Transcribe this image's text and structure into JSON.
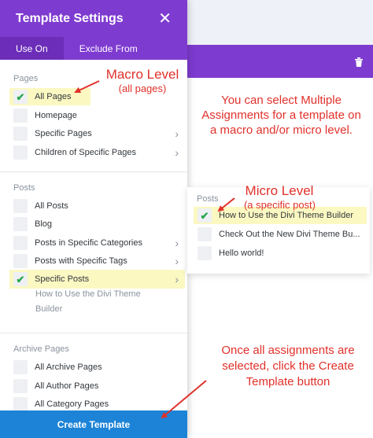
{
  "modal": {
    "title": "Template Settings",
    "close_icon": "close-icon",
    "tabs": [
      {
        "label": "Use On",
        "active": true
      },
      {
        "label": "Exclude From",
        "active": false
      }
    ]
  },
  "pages_section": {
    "label": "Pages",
    "items": [
      {
        "label": "All Pages",
        "checked": true
      },
      {
        "label": "Homepage",
        "checked": false
      },
      {
        "label": "Specific Pages",
        "checked": false,
        "has_submenu": true
      },
      {
        "label": "Children of Specific Pages",
        "checked": false,
        "has_submenu": true
      }
    ]
  },
  "posts_section": {
    "label": "Posts",
    "items": [
      {
        "label": "All Posts",
        "checked": false
      },
      {
        "label": "Blog",
        "checked": false
      },
      {
        "label": "Posts in Specific Categories",
        "checked": false,
        "has_submenu": true
      },
      {
        "label": "Posts with Specific Tags",
        "checked": false,
        "has_submenu": true
      },
      {
        "label": "Specific Posts",
        "checked": true,
        "has_submenu": true
      }
    ],
    "selected_sub": "How to Use the Divi Theme Builder"
  },
  "archive_section": {
    "label": "Archive Pages",
    "items": [
      {
        "label": "All Archive Pages",
        "checked": false
      },
      {
        "label": "All Author Pages",
        "checked": false
      },
      {
        "label": "All Category Pages",
        "checked": false
      }
    ]
  },
  "create_button": "Create Template",
  "posts_panel": {
    "label": "Posts",
    "items": [
      {
        "label": "How to Use the Divi Theme Builder",
        "checked": true
      },
      {
        "label": "Check Out the New Divi Theme Bu...",
        "checked": false
      },
      {
        "label": "Hello world!",
        "checked": false
      }
    ]
  },
  "annotations": {
    "macro_title": "Macro Level",
    "macro_sub": "(all pages)",
    "multiple": "You can select  Multiple Assignments for a template on a macro and/or micro level.",
    "micro_title": "Micro Level",
    "micro_sub": "(a specific post)",
    "create_note": "Once all assignments are selected, click the Create Template button"
  },
  "colors": {
    "purple": "#7e3bd0",
    "blue": "#1c83d7",
    "check_green": "#27a64f",
    "annotation_red": "#e0312b",
    "highlight": "#fbf8c2"
  }
}
